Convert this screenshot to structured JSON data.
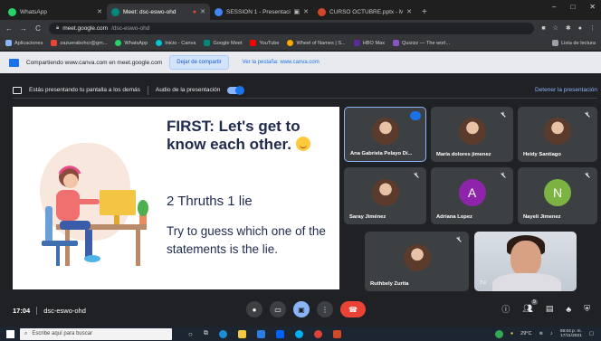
{
  "browser": {
    "tabs": [
      {
        "label": "WhatsApp",
        "color": "#25d366",
        "active": false
      },
      {
        "label": "Meet: dsc-eswo-ohd",
        "color": "#00897b",
        "active": true
      },
      {
        "label": "SESSION 1 - Presentación",
        "color": "#4285f4",
        "active": false
      },
      {
        "label": "CURSO OCTUBRE.pptx - Microsoft",
        "color": "#d24726",
        "active": false
      }
    ],
    "window_controls": {
      "minimize": "–",
      "maximize": "□",
      "close": "✕"
    },
    "url_host": "meet.google.com",
    "url_path": "/dsc-eswo-ohd",
    "bookmarks": [
      {
        "label": "Aplicaciones",
        "color": "#8ab4f8"
      },
      {
        "label": "zazuerabohcr@gm...",
        "color": "#ea4335"
      },
      {
        "label": "WhatsApp",
        "color": "#25d366"
      },
      {
        "label": "Inicio - Canva",
        "color": "#00c4cc"
      },
      {
        "label": "Google Meet",
        "color": "#00897b"
      },
      {
        "label": "YouTube",
        "color": "#ff0000"
      },
      {
        "label": "Wheel of Names | S...",
        "color": "#f9ab00"
      },
      {
        "label": "HBO Max",
        "color": "#5b2b99"
      },
      {
        "label": "Quizizz — The worl...",
        "color": "#8854c0"
      }
    ],
    "bookmarks_list": "Lista de lectura"
  },
  "sharebar": {
    "text": "Compartiendo www.canva.com en meet.google.com",
    "stop_label": "Dejar de compartir",
    "switch_label": "Ver la pestaña: www.canva.com"
  },
  "meet": {
    "presenting_text": "Estás presentando tu pantalla a los demás",
    "audio_label": "Audio de la presentación",
    "stop_presenting": "Detener la presentación",
    "slide": {
      "title": "FIRST: Let's get to know each other.",
      "subtitle": "2 Thruths 1 lie",
      "body": "Try to guess which one of the statements is the lie."
    },
    "participants": [
      {
        "name": "Ana Gabriela Pelayo Dí...",
        "avatar": "photo",
        "speaking": true
      },
      {
        "name": "María dolores jimenez",
        "avatar": "photo",
        "speaking": false
      },
      {
        "name": "Heidy Santiago",
        "avatar": "photo",
        "speaking": false
      },
      {
        "name": "Saray Jiménez",
        "avatar": "photo",
        "speaking": false
      },
      {
        "name": "Adriana Lopez",
        "avatar": "A",
        "avatar_color": "#8e24aa",
        "speaking": false
      },
      {
        "name": "Nayeli Jimenez",
        "avatar": "N",
        "avatar_color": "#7cb342",
        "speaking": false
      },
      {
        "name": "Ruthbely Zurita",
        "avatar": "photo",
        "speaking": false
      }
    ],
    "self_label": "Tú",
    "meeting_time": "17:04",
    "meeting_code": "dsc-eswo-ohd",
    "participant_count": "9"
  },
  "taskbar": {
    "search_placeholder": "Escribe aquí para buscar",
    "temperature": "29°C",
    "time": "05:04 p. m.",
    "date": "17/11/2021"
  }
}
